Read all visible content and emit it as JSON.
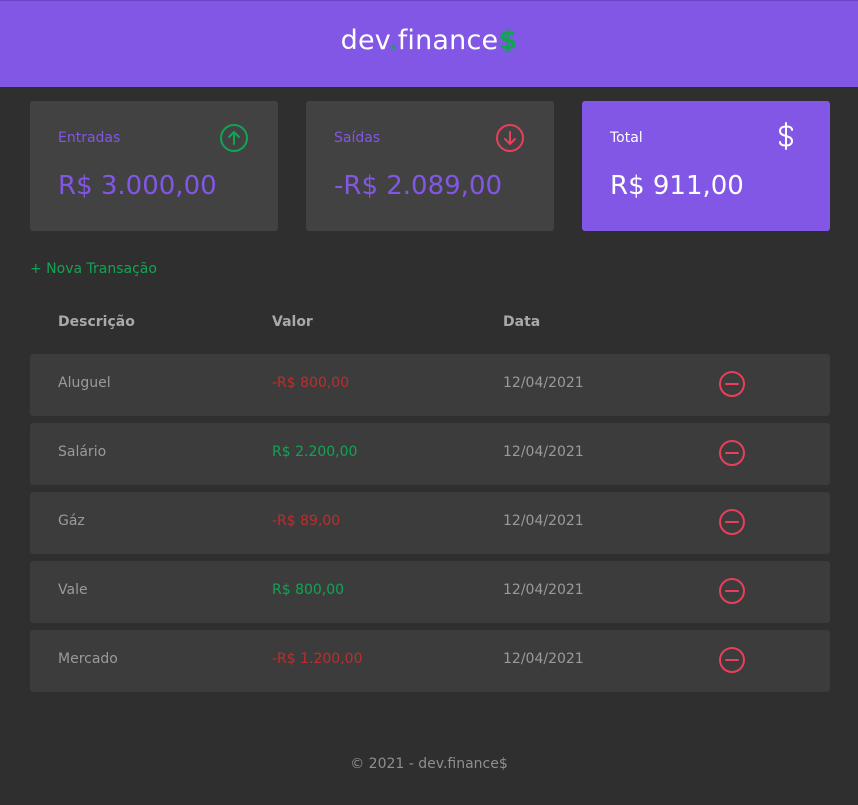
{
  "header": {
    "logo_main": "dev",
    "logo_dot": ".",
    "logo_rest": "finance",
    "logo_dollar": "$"
  },
  "cards": {
    "income": {
      "label": "Entradas",
      "value": "R$ 3.000,00",
      "icon": "arrow-up-circle-icon"
    },
    "expense": {
      "label": "Saídas",
      "value": "-R$ 2.089,00",
      "icon": "arrow-down-circle-icon"
    },
    "total": {
      "label": "Total",
      "value": "R$ 911,00",
      "icon": "dollar-icon"
    }
  },
  "new_transaction_label": "+ Nova Transação",
  "table": {
    "headers": [
      "Descrição",
      "Valor",
      "Data"
    ],
    "rows": [
      {
        "description": "Aluguel",
        "amount": "-R$ 800,00",
        "type": "expense",
        "date": "12/04/2021"
      },
      {
        "description": "Salário",
        "amount": "R$ 2.200,00",
        "type": "income",
        "date": "12/04/2021"
      },
      {
        "description": "Gáz",
        "amount": "-R$ 89,00",
        "type": "expense",
        "date": "12/04/2021"
      },
      {
        "description": "Vale",
        "amount": "R$ 800,00",
        "type": "income",
        "date": "12/04/2021"
      },
      {
        "description": "Mercado",
        "amount": "-R$ 1.200,00",
        "type": "expense",
        "date": "12/04/2021"
      }
    ]
  },
  "footer": "© 2021 - dev.finance$",
  "colors": {
    "brand": "#8257e5",
    "income": "#12a454",
    "expense": "#e92929",
    "background": "#2f2f2f",
    "card": "#424242"
  }
}
